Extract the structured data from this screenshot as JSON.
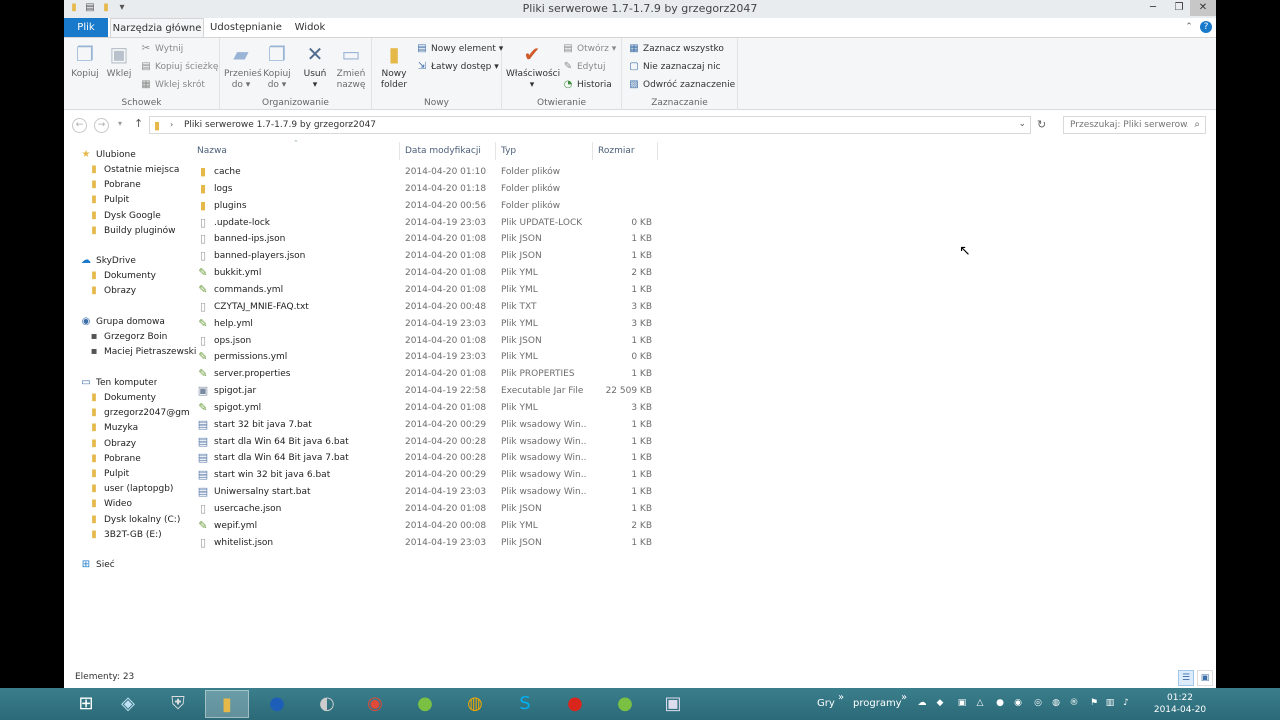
{
  "window": {
    "title": "Pliki serwerowe 1.7-1.7.9 by grzegorz2047",
    "controls": {
      "minimize": "─",
      "maximize": "❐",
      "close": "✕"
    }
  },
  "tabs": {
    "file": "Plik",
    "home": "Narzędzia główne",
    "share": "Udostępnianie",
    "view": "Widok"
  },
  "ribbon": {
    "clipboard": {
      "label": "Schowek",
      "copy": "Kopiuj",
      "paste": "Wklej",
      "cut": "Wytnij",
      "copy_path": "Kopiuj ścieżkę",
      "paste_shortcut": "Wklej skrót"
    },
    "organize": {
      "label": "Organizowanie",
      "move_to_1": "Przenieś",
      "move_to_2": "do",
      "copy_to_1": "Kopiuj",
      "copy_to_2": "do",
      "delete": "Usuń",
      "rename_1": "Zmień",
      "rename_2": "nazwę"
    },
    "new": {
      "label": "Nowy",
      "new_folder_1": "Nowy",
      "new_folder_2": "folder",
      "new_item": "Nowy element",
      "easy_access": "Łatwy dostęp"
    },
    "open": {
      "label": "Otwieranie",
      "properties": "Właściwości",
      "open": "Otwórz",
      "edit": "Edytuj",
      "history": "Historia"
    },
    "select": {
      "label": "Zaznaczanie",
      "select_all": "Zaznacz wszystko",
      "select_none": "Nie zaznaczaj nic",
      "invert": "Odwróć zaznaczenie"
    }
  },
  "address": {
    "path": "Pliki serwerowe 1.7-1.7.9 by grzegorz2047",
    "search_placeholder": "Przeszukaj: Pliki serwerow..."
  },
  "navpane": {
    "favorites": "Ulubione",
    "fav_items": [
      "Ostatnie miejsca",
      "Pobrane",
      "Pulpit",
      "Dysk Google",
      "Buildy pluginów"
    ],
    "skydrive": "SkyDrive",
    "sky_items": [
      "Dokumenty",
      "Obrazy"
    ],
    "homegroup": "Grupa domowa",
    "home_items": [
      "Grzegorz Boin",
      "Maciej Pietraszewski"
    ],
    "computer": "Ten komputer",
    "comp_items": [
      "Dokumenty",
      "grzegorz2047@gm",
      "Muzyka",
      "Obrazy",
      "Pobrane",
      "Pulpit",
      "user (laptopgb)",
      "Wideo",
      "Dysk lokalny (C:)",
      "3B2T-GB (E:)"
    ],
    "network": "Sieć"
  },
  "columns": {
    "name": "Nazwa",
    "date": "Data modyfikacji",
    "type": "Typ",
    "size": "Rozmiar"
  },
  "files": [
    {
      "name": "cache",
      "date": "2014-04-20 01:10",
      "type": "Folder plików",
      "size": "",
      "icon": "folder"
    },
    {
      "name": "logs",
      "date": "2014-04-20 01:18",
      "type": "Folder plików",
      "size": "",
      "icon": "folder"
    },
    {
      "name": "plugins",
      "date": "2014-04-20 00:56",
      "type": "Folder plików",
      "size": "",
      "icon": "folder"
    },
    {
      "name": ".update-lock",
      "date": "2014-04-19 23:03",
      "type": "Plik UPDATE-LOCK",
      "size": "0 KB",
      "icon": "file"
    },
    {
      "name": "banned-ips.json",
      "date": "2014-04-20 01:08",
      "type": "Plik JSON",
      "size": "1 KB",
      "icon": "file"
    },
    {
      "name": "banned-players.json",
      "date": "2014-04-20 01:08",
      "type": "Plik JSON",
      "size": "1 KB",
      "icon": "file"
    },
    {
      "name": "bukkit.yml",
      "date": "2014-04-20 01:08",
      "type": "Plik YML",
      "size": "2 KB",
      "icon": "yml"
    },
    {
      "name": "commands.yml",
      "date": "2014-04-20 01:08",
      "type": "Plik YML",
      "size": "1 KB",
      "icon": "yml"
    },
    {
      "name": "CZYTAJ_MNIE-FAQ.txt",
      "date": "2014-04-20 00:48",
      "type": "Plik TXT",
      "size": "3 KB",
      "icon": "file"
    },
    {
      "name": "help.yml",
      "date": "2014-04-19 23:03",
      "type": "Plik YML",
      "size": "3 KB",
      "icon": "yml"
    },
    {
      "name": "ops.json",
      "date": "2014-04-20 01:08",
      "type": "Plik JSON",
      "size": "1 KB",
      "icon": "file"
    },
    {
      "name": "permissions.yml",
      "date": "2014-04-19 23:03",
      "type": "Plik YML",
      "size": "0 KB",
      "icon": "yml"
    },
    {
      "name": "server.properties",
      "date": "2014-04-20 01:08",
      "type": "Plik PROPERTIES",
      "size": "1 KB",
      "icon": "yml"
    },
    {
      "name": "spigot.jar",
      "date": "2014-04-19 22:58",
      "type": "Executable Jar File",
      "size": "22 509 KB",
      "icon": "jar"
    },
    {
      "name": "spigot.yml",
      "date": "2014-04-20 01:08",
      "type": "Plik YML",
      "size": "3 KB",
      "icon": "yml"
    },
    {
      "name": "start 32 bit java 7.bat",
      "date": "2014-04-20 00:29",
      "type": "Plik wsadowy Win...",
      "size": "1 KB",
      "icon": "bat"
    },
    {
      "name": "start dla Win 64 Bit java 6.bat",
      "date": "2014-04-20 00:28",
      "type": "Plik wsadowy Win...",
      "size": "1 KB",
      "icon": "bat"
    },
    {
      "name": "start dla Win 64 Bit java 7.bat",
      "date": "2014-04-20 00:28",
      "type": "Plik wsadowy Win...",
      "size": "1 KB",
      "icon": "bat"
    },
    {
      "name": "start win 32 bit java 6.bat",
      "date": "2014-04-20 00:29",
      "type": "Plik wsadowy Win...",
      "size": "1 KB",
      "icon": "bat"
    },
    {
      "name": "Uniwersalny start.bat",
      "date": "2014-04-19 23:03",
      "type": "Plik wsadowy Win...",
      "size": "1 KB",
      "icon": "bat"
    },
    {
      "name": "usercache.json",
      "date": "2014-04-20 01:08",
      "type": "Plik JSON",
      "size": "1 KB",
      "icon": "file"
    },
    {
      "name": "wepif.yml",
      "date": "2014-04-20 00:08",
      "type": "Plik YML",
      "size": "2 KB",
      "icon": "yml"
    },
    {
      "name": "whitelist.json",
      "date": "2014-04-19 23:03",
      "type": "Plik JSON",
      "size": "1 KB",
      "icon": "file"
    }
  ],
  "status": {
    "items": "Elementy: 23"
  },
  "taskbar": {
    "toolbar1": "Gry",
    "toolbar2": "programy",
    "time": "01:22",
    "date": "2014-04-20"
  },
  "colors": {
    "accent": "#1979ca",
    "folder": "#e5b84a",
    "taskbar": "#33737f"
  }
}
